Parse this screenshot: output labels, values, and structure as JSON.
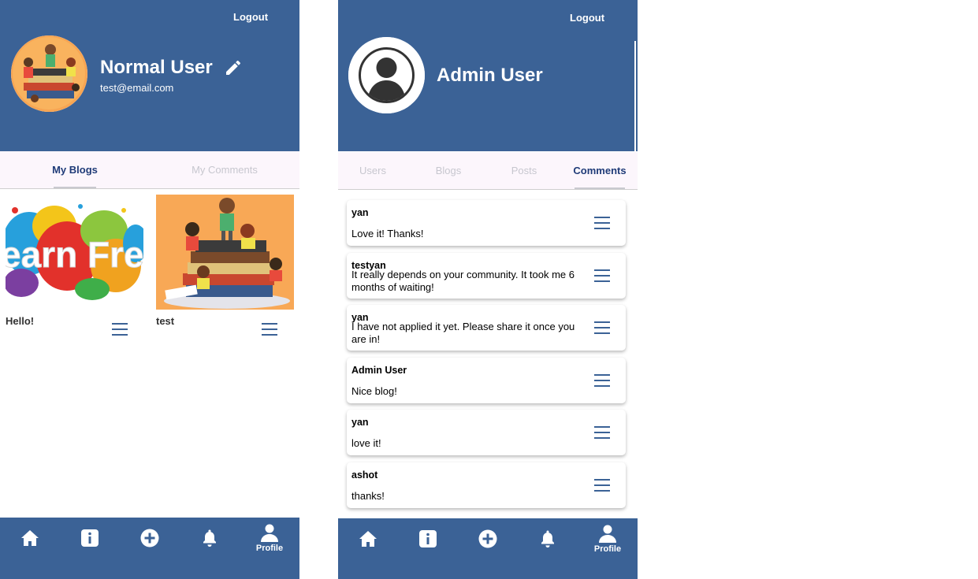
{
  "left_screen": {
    "header": {
      "logout_label": "Logout",
      "user_name": "Normal User",
      "user_email": "test@email.com"
    },
    "tabs": [
      {
        "label": "My Blogs",
        "active": true
      },
      {
        "label": "My Comments",
        "active": false
      }
    ],
    "blogs": [
      {
        "title": "Hello!",
        "image": "colorful-paint-splash-banner"
      },
      {
        "title": "test",
        "image": "kids-reading-books-illustration"
      }
    ],
    "bottom_nav": [
      {
        "icon": "home-icon",
        "label": ""
      },
      {
        "icon": "info-icon",
        "label": ""
      },
      {
        "icon": "add-circle-icon",
        "label": ""
      },
      {
        "icon": "bell-icon",
        "label": ""
      },
      {
        "icon": "person-icon",
        "label": "Profile"
      }
    ]
  },
  "right_screen": {
    "header": {
      "logout_label": "Logout",
      "user_name": "Admin User"
    },
    "tabs": [
      {
        "label": "Users",
        "active": false
      },
      {
        "label": "Blogs",
        "active": false
      },
      {
        "label": "Posts",
        "active": false
      },
      {
        "label": "Comments",
        "active": true
      }
    ],
    "comments": [
      {
        "author": "yan",
        "text": "Love it! Thanks!"
      },
      {
        "author": "testyan",
        "text": "It really depends on your community. It took me 6 months of waiting!"
      },
      {
        "author": "yan",
        "text": "I have not applied it yet. Please share it once you are in!"
      },
      {
        "author": "Admin User",
        "text": "Nice blog!"
      },
      {
        "author": "yan",
        "text": "love it!"
      },
      {
        "author": "ashot",
        "text": "thanks!"
      }
    ],
    "bottom_nav": [
      {
        "icon": "home-icon",
        "label": ""
      },
      {
        "icon": "info-icon",
        "label": ""
      },
      {
        "icon": "add-circle-icon",
        "label": ""
      },
      {
        "icon": "bell-icon",
        "label": ""
      },
      {
        "icon": "person-icon",
        "label": "Profile"
      }
    ]
  },
  "colors": {
    "primary": "#3b6296",
    "active_tab_text": "#1f3b78",
    "inactive_tab_text": "#c7c7cf",
    "tab_bar_background": "#fcf6fc",
    "menu_icon": "#3b6296"
  }
}
